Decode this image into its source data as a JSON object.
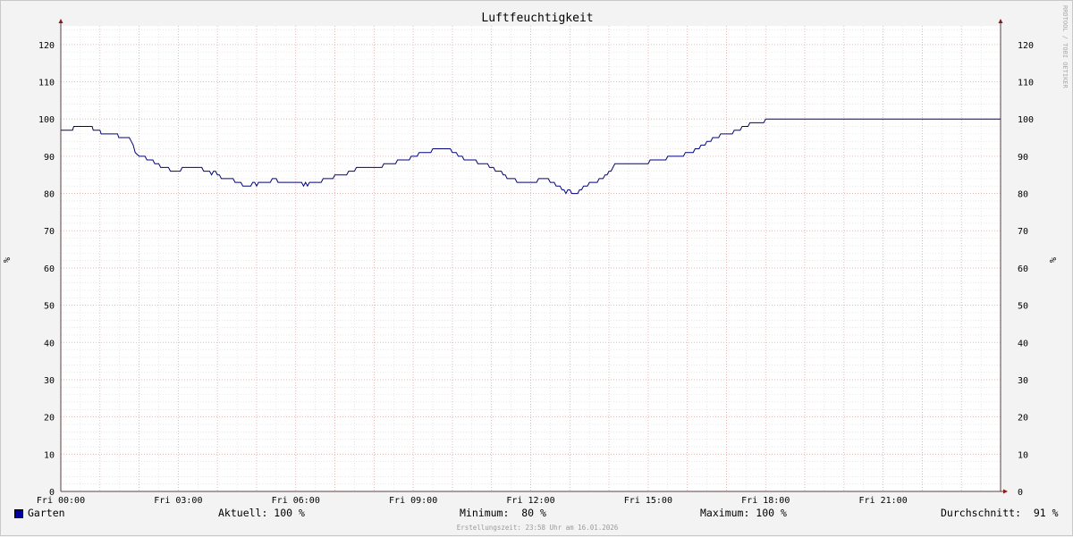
{
  "chart_data": {
    "type": "line",
    "title": "Luftfeuchtigkeit",
    "ylabel": "%",
    "ylim": [
      0,
      125
    ],
    "yticks": [
      "0",
      "10",
      "20",
      "30",
      "40",
      "50",
      "60",
      "70",
      "80",
      "90",
      "100",
      "110",
      "120"
    ],
    "xlim": [
      0,
      24
    ],
    "xticks": [
      {
        "x": 0,
        "label": "Fri 00:00"
      },
      {
        "x": 3,
        "label": "Fri 03:00"
      },
      {
        "x": 6,
        "label": "Fri 06:00"
      },
      {
        "x": 9,
        "label": "Fri 09:00"
      },
      {
        "x": 12,
        "label": "Fri 12:00"
      },
      {
        "x": 15,
        "label": "Fri 15:00"
      },
      {
        "x": 18,
        "label": "Fri 18:00"
      },
      {
        "x": 21,
        "label": "Fri 21:00"
      }
    ],
    "grid": true,
    "series": [
      {
        "name": "Garten",
        "color": "#000080",
        "points": [
          [
            0,
            97
          ],
          [
            0.3,
            97
          ],
          [
            0.33,
            98
          ],
          [
            0.8,
            98
          ],
          [
            0.83,
            97
          ],
          [
            1.0,
            97
          ],
          [
            1.03,
            96
          ],
          [
            1.45,
            96
          ],
          [
            1.48,
            95
          ],
          [
            1.75,
            95
          ],
          [
            1.8,
            94
          ],
          [
            1.85,
            93
          ],
          [
            1.9,
            91
          ],
          [
            2.0,
            90
          ],
          [
            2.15,
            90
          ],
          [
            2.2,
            89
          ],
          [
            2.35,
            89
          ],
          [
            2.4,
            88
          ],
          [
            2.5,
            88
          ],
          [
            2.55,
            87
          ],
          [
            2.75,
            87
          ],
          [
            2.8,
            86
          ],
          [
            3.05,
            86
          ],
          [
            3.1,
            87
          ],
          [
            3.6,
            87
          ],
          [
            3.65,
            86
          ],
          [
            3.8,
            86
          ],
          [
            3.85,
            85
          ],
          [
            3.9,
            86
          ],
          [
            3.95,
            86
          ],
          [
            4.0,
            85
          ],
          [
            4.05,
            85
          ],
          [
            4.1,
            84
          ],
          [
            4.4,
            84
          ],
          [
            4.45,
            83
          ],
          [
            4.6,
            83
          ],
          [
            4.65,
            82
          ],
          [
            4.85,
            82
          ],
          [
            4.9,
            83
          ],
          [
            4.95,
            83
          ],
          [
            5.0,
            82
          ],
          [
            5.05,
            83
          ],
          [
            5.35,
            83
          ],
          [
            5.4,
            84
          ],
          [
            5.5,
            84
          ],
          [
            5.55,
            83
          ],
          [
            6.15,
            83
          ],
          [
            6.2,
            82
          ],
          [
            6.25,
            83
          ],
          [
            6.3,
            82
          ],
          [
            6.35,
            83
          ],
          [
            6.65,
            83
          ],
          [
            6.7,
            84
          ],
          [
            6.95,
            84
          ],
          [
            7.0,
            85
          ],
          [
            7.3,
            85
          ],
          [
            7.35,
            86
          ],
          [
            7.5,
            86
          ],
          [
            7.55,
            87
          ],
          [
            8.2,
            87
          ],
          [
            8.25,
            88
          ],
          [
            8.55,
            88
          ],
          [
            8.6,
            89
          ],
          [
            8.9,
            89
          ],
          [
            8.95,
            90
          ],
          [
            9.1,
            90
          ],
          [
            9.15,
            91
          ],
          [
            9.45,
            91
          ],
          [
            9.5,
            92
          ],
          [
            9.95,
            92
          ],
          [
            10.0,
            91
          ],
          [
            10.1,
            91
          ],
          [
            10.15,
            90
          ],
          [
            10.25,
            90
          ],
          [
            10.3,
            89
          ],
          [
            10.6,
            89
          ],
          [
            10.65,
            88
          ],
          [
            10.9,
            88
          ],
          [
            10.95,
            87
          ],
          [
            11.05,
            87
          ],
          [
            11.1,
            86
          ],
          [
            11.25,
            86
          ],
          [
            11.3,
            85
          ],
          [
            11.35,
            85
          ],
          [
            11.4,
            84
          ],
          [
            11.6,
            84
          ],
          [
            11.65,
            83
          ],
          [
            12.15,
            83
          ],
          [
            12.2,
            84
          ],
          [
            12.45,
            84
          ],
          [
            12.5,
            83
          ],
          [
            12.6,
            83
          ],
          [
            12.65,
            82
          ],
          [
            12.75,
            82
          ],
          [
            12.8,
            81
          ],
          [
            12.85,
            81
          ],
          [
            12.9,
            80
          ],
          [
            12.95,
            81
          ],
          [
            13.0,
            81
          ],
          [
            13.05,
            80
          ],
          [
            13.2,
            80
          ],
          [
            13.25,
            81
          ],
          [
            13.3,
            81
          ],
          [
            13.35,
            82
          ],
          [
            13.45,
            82
          ],
          [
            13.5,
            83
          ],
          [
            13.7,
            83
          ],
          [
            13.75,
            84
          ],
          [
            13.85,
            84
          ],
          [
            13.9,
            85
          ],
          [
            13.95,
            85
          ],
          [
            14.0,
            86
          ],
          [
            14.05,
            86
          ],
          [
            14.1,
            87
          ],
          [
            14.15,
            88
          ],
          [
            15.0,
            88
          ],
          [
            15.05,
            89
          ],
          [
            15.45,
            89
          ],
          [
            15.5,
            90
          ],
          [
            15.9,
            90
          ],
          [
            15.95,
            91
          ],
          [
            16.15,
            91
          ],
          [
            16.2,
            92
          ],
          [
            16.3,
            92
          ],
          [
            16.35,
            93
          ],
          [
            16.45,
            93
          ],
          [
            16.5,
            94
          ],
          [
            16.6,
            94
          ],
          [
            16.65,
            95
          ],
          [
            16.8,
            95
          ],
          [
            16.85,
            96
          ],
          [
            17.15,
            96
          ],
          [
            17.2,
            97
          ],
          [
            17.35,
            97
          ],
          [
            17.4,
            98
          ],
          [
            17.55,
            98
          ],
          [
            17.6,
            99
          ],
          [
            17.95,
            99
          ],
          [
            18.0,
            100
          ],
          [
            24,
            100
          ]
        ]
      }
    ],
    "stats": {
      "current": "Aktuell: 100 %",
      "minimum": "Minimum:  80 %",
      "maximum": "Maximum: 100 %",
      "average": "Durchschnitt:  91 %"
    },
    "watermark": "RRDTOOL / TOBI OETIKER",
    "footer": "Erstellungszeit: 23:58 Uhr am 16.01.2026"
  }
}
